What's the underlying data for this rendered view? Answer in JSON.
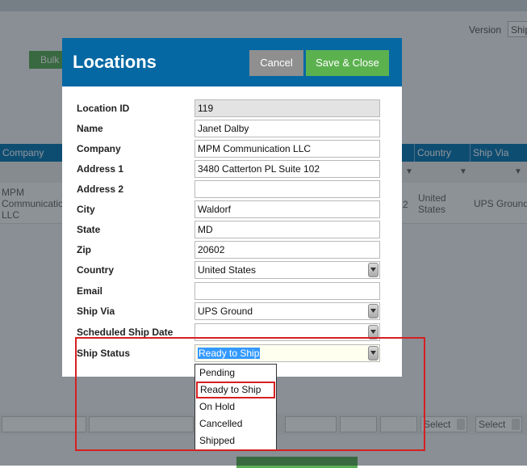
{
  "background": {
    "version_label": "Version",
    "version_value": "Ship",
    "bulk_button": "Bulk",
    "table_headers": {
      "company": "Company",
      "country": "Country",
      "ship_via": "Ship Via"
    },
    "row": {
      "company": "MPM Communication LLC",
      "col_partial": "2",
      "country": "United States",
      "ship_via": "UPS Ground"
    },
    "footer_select_1": "Select",
    "footer_select_2": "Select"
  },
  "modal": {
    "title": "Locations",
    "cancel_label": "Cancel",
    "save_label": "Save & Close",
    "fields": [
      {
        "label": "Location ID",
        "value": "119"
      },
      {
        "label": "Name",
        "value": "Janet Dalby"
      },
      {
        "label": "Company",
        "value": "MPM Communication LLC"
      },
      {
        "label": "Address 1",
        "value": "3480 Catterton PL Suite 102"
      },
      {
        "label": "Address 2",
        "value": ""
      },
      {
        "label": "City",
        "value": "Waldorf"
      },
      {
        "label": "State",
        "value": "MD"
      },
      {
        "label": "Zip",
        "value": "20602"
      },
      {
        "label": "Country",
        "value": "United States"
      },
      {
        "label": "Email",
        "value": ""
      },
      {
        "label": "Ship Via",
        "value": "UPS Ground"
      },
      {
        "label": "Scheduled Ship Date",
        "value": ""
      },
      {
        "label": "Ship Status",
        "value": "Ready to Ship"
      }
    ]
  },
  "ship_status_options": [
    "Pending",
    "Ready to Ship",
    "On Hold",
    "Cancelled",
    "Shipped"
  ],
  "colors": {
    "header_blue": "#0568a3",
    "save_green": "#5cb14f",
    "cancel_gray": "#8f8f8f",
    "highlight_red": "#d62020",
    "selection_blue": "#3399ff"
  }
}
